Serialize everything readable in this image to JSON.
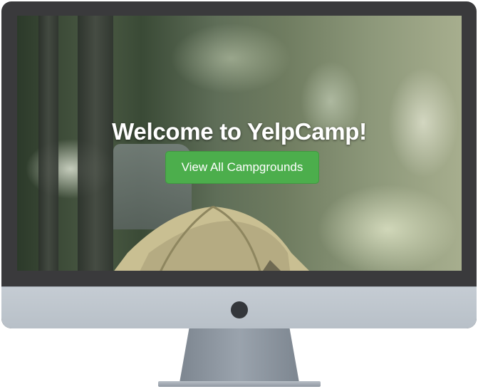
{
  "hero": {
    "title": "Welcome to YelpCamp!",
    "button_label": "View All Campgrounds"
  },
  "colors": {
    "button_green": "#4cae4c",
    "monitor_frame": "#3a3a3c",
    "monitor_chin": "#c5ccd3"
  },
  "icons": {
    "power": "power-dot-icon"
  }
}
